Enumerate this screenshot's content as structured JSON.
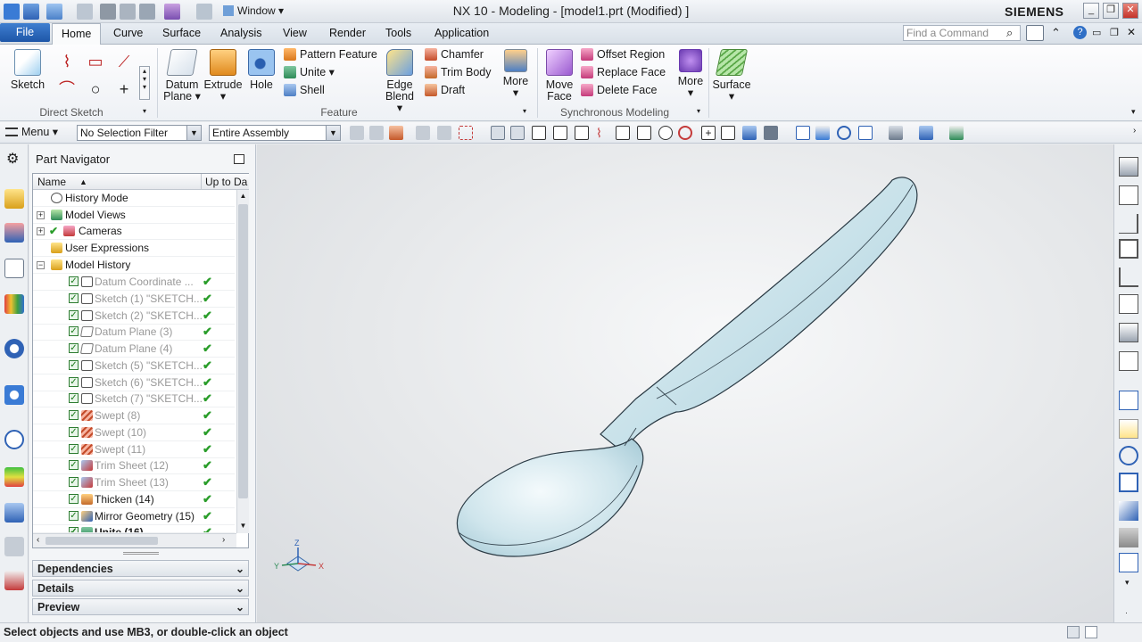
{
  "titlebar": {
    "title": "NX 10 - Modeling - [model1.prt (Modified) ]",
    "brand": "SIEMENS",
    "window_menu": "Window",
    "min": "_",
    "restore": "❐",
    "close": "✕"
  },
  "tabs": {
    "file": "File",
    "items": [
      "Home",
      "Curve",
      "Surface",
      "Analysis",
      "View",
      "Render",
      "Tools",
      "Application"
    ],
    "active": "Home",
    "find_placeholder": "Find a Command"
  },
  "ribbon": {
    "direct_sketch": {
      "label": "Direct Sketch",
      "sketch": "Sketch"
    },
    "feature": {
      "label": "Feature",
      "datum_plane": "Datum Plane",
      "datum_plane_l1": "Datum",
      "datum_plane_l2": "Plane",
      "extrude": "Extrude",
      "hole": "Hole",
      "pattern_feature": "Pattern Feature",
      "unite": "Unite",
      "shell": "Shell",
      "edge_blend_l1": "Edge",
      "edge_blend_l2": "Blend",
      "chamfer": "Chamfer",
      "trim_body": "Trim Body",
      "draft": "Draft",
      "more": "More"
    },
    "sync": {
      "label": "Synchronous Modeling",
      "move_face_l1": "Move",
      "move_face_l2": "Face",
      "offset_region": "Offset Region",
      "replace_face": "Replace Face",
      "delete_face": "Delete Face",
      "more": "More"
    },
    "surface": {
      "label": "Surface"
    }
  },
  "toolbar": {
    "menu": "Menu",
    "selection_filter": "No Selection Filter",
    "scope": "Entire Assembly"
  },
  "navigator": {
    "title": "Part Navigator",
    "col_name": "Name",
    "col_uptodate": "Up to Da",
    "rows": [
      {
        "label": "History Mode"
      },
      {
        "label": "Model Views"
      },
      {
        "label": "Cameras"
      },
      {
        "label": "User Expressions"
      },
      {
        "label": "Model History"
      },
      {
        "label": "Datum Coordinate ..."
      },
      {
        "label": "Sketch (1) \"SKETCH..."
      },
      {
        "label": "Sketch (2) \"SKETCH..."
      },
      {
        "label": "Datum Plane (3)"
      },
      {
        "label": "Datum Plane (4)"
      },
      {
        "label": "Sketch (5) \"SKETCH..."
      },
      {
        "label": "Sketch (6) \"SKETCH..."
      },
      {
        "label": "Sketch (7) \"SKETCH..."
      },
      {
        "label": "Swept (8)"
      },
      {
        "label": "Swept (10)"
      },
      {
        "label": "Swept (11)"
      },
      {
        "label": "Trim Sheet (12)"
      },
      {
        "label": "Trim Sheet (13)"
      },
      {
        "label": "Thicken (14)"
      },
      {
        "label": "Mirror Geometry (15)"
      },
      {
        "label": "Unite (16)"
      }
    ],
    "panels": {
      "dependencies": "Dependencies",
      "details": "Details",
      "preview": "Preview"
    }
  },
  "triad": {
    "x": "X",
    "y": "Y",
    "z": "Z"
  },
  "status": {
    "text": "Select objects and use MB3, or double-click an object"
  },
  "colors": {
    "accent": "#1e56a8",
    "check": "#2a9d2a",
    "spoon": "#cde4ec"
  }
}
